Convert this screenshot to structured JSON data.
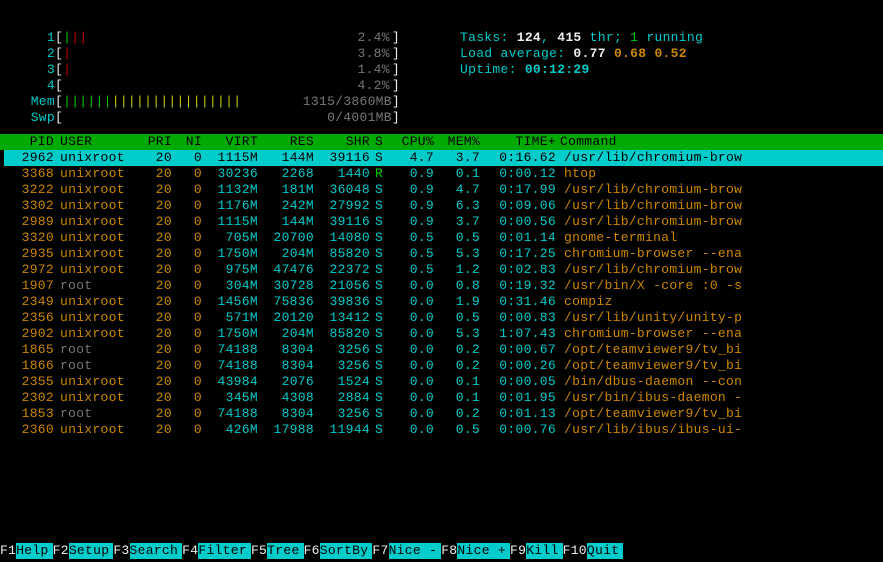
{
  "cpus": [
    {
      "n": "1",
      "bars": "|||",
      "style": "gr",
      "pct": "2.4%"
    },
    {
      "n": "2",
      "bars": "|",
      "style": "r",
      "pct": "3.8%"
    },
    {
      "n": "3",
      "bars": "|",
      "style": "r",
      "pct": "1.4%"
    },
    {
      "n": "4",
      "bars": "",
      "style": "",
      "pct": "4.2%"
    }
  ],
  "mem": {
    "label": "Mem",
    "bars": "||||||||||||||||||||||",
    "used": "1315/3860MB"
  },
  "swp": {
    "label": "Swp",
    "used": "0/4001MB"
  },
  "stats": {
    "tasks_label": "Tasks: ",
    "tasks_a": "124",
    "tasks_sep": ", ",
    "tasks_b": "415",
    "tasks_thr": " thr; ",
    "running_n": "1",
    "running_lbl": " running",
    "load_lbl": "Load average: ",
    "load1": "0.77",
    "load2": "0.68",
    "load3": "0.52",
    "uptime_lbl": "Uptime: ",
    "uptime": "00:12:29"
  },
  "headers": [
    "PID",
    "USER",
    "PRI",
    "NI",
    "VIRT",
    "RES",
    "SHR",
    "S",
    "CPU%",
    "MEM%",
    "TIME+",
    "Command"
  ],
  "rows": [
    {
      "sel": true,
      "pid": "2962",
      "user": "unixroot",
      "pri": "20",
      "ni": "0",
      "virt": "1115M",
      "res": "144M",
      "shr": "39116",
      "s": "S",
      "cpu": "4.7",
      "mem": "3.7",
      "time": "0:16.62",
      "cmd": "/usr/lib/chromium-brow"
    },
    {
      "pid": "3368",
      "user": "unixroot",
      "pri": "20",
      "ni": "0",
      "virt": "30236",
      "res": "2268",
      "shr": "1440",
      "s": "R",
      "scol": "green",
      "cpu": "0.9",
      "mem": "0.1",
      "time": "0:00.12",
      "cmd": "htop"
    },
    {
      "pid": "3222",
      "user": "unixroot",
      "pri": "20",
      "ni": "0",
      "virt": "1132M",
      "res": "181M",
      "shr": "36048",
      "s": "S",
      "cpu": "0.9",
      "mem": "4.7",
      "time": "0:17.99",
      "cmd": "/usr/lib/chromium-brow"
    },
    {
      "pid": "3302",
      "user": "unixroot",
      "pri": "20",
      "ni": "0",
      "virt": "1176M",
      "res": "242M",
      "shr": "27992",
      "s": "S",
      "cpu": "0.9",
      "mem": "6.3",
      "time": "0:09.06",
      "cmd": "/usr/lib/chromium-brow"
    },
    {
      "pid": "2989",
      "user": "unixroot",
      "pri": "20",
      "ni": "0",
      "virt": "1115M",
      "res": "144M",
      "shr": "39116",
      "s": "S",
      "cpu": "0.9",
      "mem": "3.7",
      "time": "0:00.56",
      "cmd": "/usr/lib/chromium-brow"
    },
    {
      "pid": "3320",
      "user": "unixroot",
      "pri": "20",
      "ni": "0",
      "virt": "705M",
      "res": "20700",
      "shr": "14080",
      "s": "S",
      "cpu": "0.5",
      "mem": "0.5",
      "time": "0:01.14",
      "cmd": "gnome-terminal"
    },
    {
      "pid": "2935",
      "user": "unixroot",
      "pri": "20",
      "ni": "0",
      "virt": "1750M",
      "res": "204M",
      "shr": "85820",
      "s": "S",
      "cpu": "0.5",
      "mem": "5.3",
      "time": "0:17.25",
      "cmd": "chromium-browser --ena"
    },
    {
      "pid": "2972",
      "user": "unixroot",
      "pri": "20",
      "ni": "0",
      "virt": "975M",
      "res": "47476",
      "shr": "22372",
      "s": "S",
      "cpu": "0.5",
      "mem": "1.2",
      "time": "0:02.83",
      "cmd": "/usr/lib/chromium-brow"
    },
    {
      "pid": "1907",
      "user": "root",
      "ucol": "gray",
      "pri": "20",
      "ni": "0",
      "virt": "304M",
      "res": "30728",
      "shr": "21056",
      "s": "S",
      "cpu": "0.0",
      "mem": "0.8",
      "time": "0:19.32",
      "cmd": "/usr/bin/X -core :0 -s"
    },
    {
      "pid": "2349",
      "user": "unixroot",
      "pri": "20",
      "ni": "0",
      "virt": "1456M",
      "res": "75836",
      "shr": "39836",
      "s": "S",
      "cpu": "0.0",
      "mem": "1.9",
      "time": "0:31.46",
      "cmd": "compiz"
    },
    {
      "pid": "2356",
      "user": "unixroot",
      "pri": "20",
      "ni": "0",
      "virt": "571M",
      "res": "20120",
      "shr": "13412",
      "s": "S",
      "cpu": "0.0",
      "mem": "0.5",
      "time": "0:00.83",
      "cmd": "/usr/lib/unity/unity-p"
    },
    {
      "pid": "2902",
      "user": "unixroot",
      "pri": "20",
      "ni": "0",
      "virt": "1750M",
      "res": "204M",
      "shr": "85820",
      "s": "S",
      "cpu": "0.0",
      "mem": "5.3",
      "time": "1:07.43",
      "cmd": "chromium-browser --ena"
    },
    {
      "pid": "1865",
      "user": "root",
      "ucol": "gray",
      "pri": "20",
      "ni": "0",
      "virt": "74188",
      "res": "8304",
      "shr": "3256",
      "s": "S",
      "cpu": "0.0",
      "mem": "0.2",
      "time": "0:00.67",
      "cmd": "/opt/teamviewer9/tv_bi"
    },
    {
      "pid": "1866",
      "user": "root",
      "ucol": "gray",
      "pri": "20",
      "ni": "0",
      "virt": "74188",
      "res": "8304",
      "shr": "3256",
      "s": "S",
      "cpu": "0.0",
      "mem": "0.2",
      "time": "0:00.26",
      "cmd": "/opt/teamviewer9/tv_bi"
    },
    {
      "pid": "2355",
      "user": "unixroot",
      "pri": "20",
      "ni": "0",
      "virt": "43984",
      "res": "2076",
      "shr": "1524",
      "s": "S",
      "cpu": "0.0",
      "mem": "0.1",
      "time": "0:00.05",
      "cmd": "/bin/dbus-daemon --con"
    },
    {
      "pid": "2302",
      "user": "unixroot",
      "pri": "20",
      "ni": "0",
      "virt": "345M",
      "res": "4308",
      "shr": "2884",
      "s": "S",
      "cpu": "0.0",
      "mem": "0.1",
      "time": "0:01.95",
      "cmd": "/usr/bin/ibus-daemon -"
    },
    {
      "pid": "1853",
      "user": "root",
      "ucol": "gray",
      "pri": "20",
      "ni": "0",
      "virt": "74188",
      "res": "8304",
      "shr": "3256",
      "s": "S",
      "cpu": "0.0",
      "mem": "0.2",
      "time": "0:01.13",
      "cmd": "/opt/teamviewer9/tv_bi"
    },
    {
      "pid": "2360",
      "user": "unixroot",
      "pri": "20",
      "ni": "0",
      "virt": "426M",
      "res": "17988",
      "shr": "11944",
      "s": "S",
      "cpu": "0.0",
      "mem": "0.5",
      "time": "0:00.76",
      "cmd": "/usr/lib/ibus/ibus-ui-"
    }
  ],
  "footer": [
    {
      "k": "F1",
      "a": "Help  "
    },
    {
      "k": "F2",
      "a": "Setup "
    },
    {
      "k": "F3",
      "a": "Search"
    },
    {
      "k": "F4",
      "a": "Filter"
    },
    {
      "k": "F5",
      "a": "Tree  "
    },
    {
      "k": "F6",
      "a": "SortBy"
    },
    {
      "k": "F7",
      "a": "Nice -"
    },
    {
      "k": "F8",
      "a": "Nice +"
    },
    {
      "k": "F9",
      "a": "Kill  "
    },
    {
      "k": "F10",
      "a": "Quit  "
    }
  ]
}
